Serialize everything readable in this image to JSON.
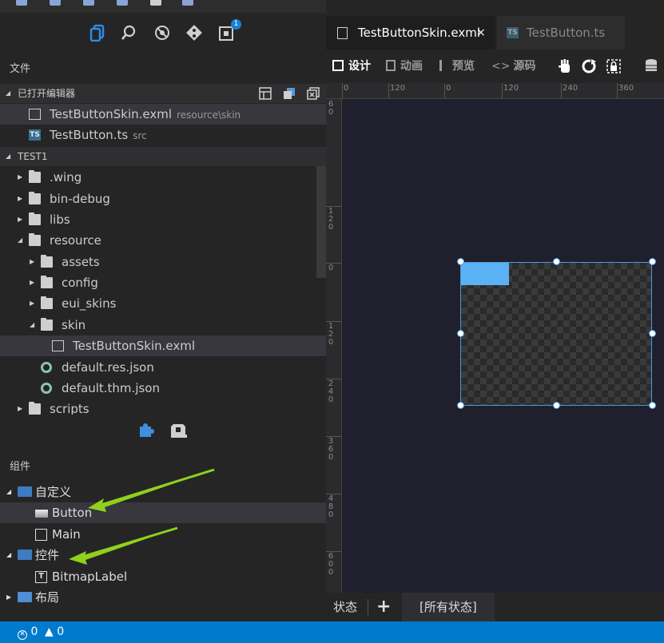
{
  "activity_bar": {
    "badge_count": "1",
    "icons": [
      "explorer-icon",
      "search-icon",
      "debug-icon",
      "git-icon",
      "extensions-icon"
    ]
  },
  "explorer": {
    "title": "文件",
    "open_editors": {
      "header": "已打开编辑器",
      "items": [
        {
          "name": "TestButtonSkin.exml",
          "desc": "resource\\skin"
        },
        {
          "name": "TestButton.ts",
          "desc": "src"
        }
      ]
    },
    "project": {
      "header": "TEST1",
      "items": [
        ".wing",
        "bin-debug",
        "libs",
        "resource",
        "assets",
        "config",
        "eui_skins",
        "skin",
        "TestButtonSkin.exml",
        "default.res.json",
        "default.thm.json",
        "scripts"
      ]
    }
  },
  "components": {
    "title": "组件",
    "tree": {
      "custom": "自定义",
      "button": "Button",
      "main": "Main",
      "controls": "控件",
      "bitmaplabel": "BitmapLabel",
      "layout": "布局"
    }
  },
  "editor": {
    "tabs": [
      {
        "label": "TestButtonSkin.exml",
        "close": "×"
      },
      {
        "label": "TestButton.ts",
        "icon_text": "TS"
      }
    ],
    "toolbar": {
      "design": "设计",
      "animation": "动画",
      "preview": "预览",
      "source": "源码"
    },
    "ruler_h": [
      "0",
      "120",
      "0",
      "120",
      "240",
      "360"
    ],
    "ruler_v": [
      "6\n0",
      "0",
      "1\n2\n0",
      "0",
      "1\n2\n0",
      "2\n4\n0",
      "3\n6\n0",
      "4\n8\n0",
      "6\n0\n0"
    ],
    "states": {
      "label": "状态",
      "add": "+",
      "all": "[所有状态]"
    }
  },
  "statusbar": {
    "errors": "0",
    "warnings": "0"
  },
  "colors": {
    "accent_blue": "#007acc",
    "selection_blue": "#4a9be0",
    "button_fill": "#5ab2f4",
    "annotation_arrow": "#8fd11b"
  }
}
